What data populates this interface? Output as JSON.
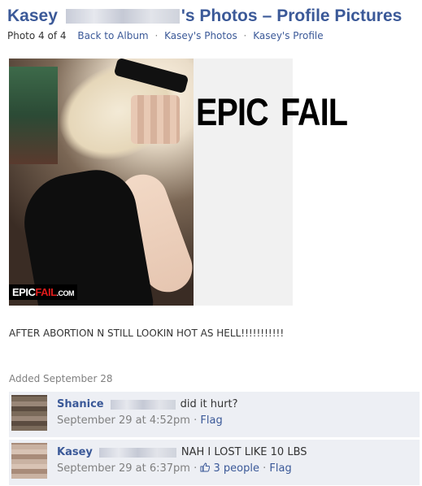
{
  "header": {
    "owner_name": "Kasey",
    "title_suffix": "'s Photos",
    "separator": "–",
    "album_title": "Profile Pictures"
  },
  "subnav": {
    "photo_position": "Photo 4 of 4",
    "links": [
      "Back to Album",
      "Kasey's Photos",
      "Kasey's Profile"
    ],
    "dot": "·"
  },
  "photo": {
    "overlay_text": "EPIC  FAIL",
    "badge": {
      "part1": "EPIC",
      "part2": "FAIL",
      "suffix": ".COM"
    }
  },
  "caption": "AFTER ABORTION N STILL LOOKIN HOT AS HELL!!!!!!!!!!!",
  "added": "Added September 28",
  "comments": [
    {
      "author": "Shanice",
      "text": "did it hurt?",
      "timestamp": "September 29 at 4:52pm",
      "flag": "Flag"
    },
    {
      "author": "Kasey",
      "text": "NAH I LOST LIKE 10 LBS",
      "timestamp": "September 29 at 6:37pm",
      "likes": "3 people",
      "flag": "Flag"
    }
  ],
  "colors": {
    "link": "#3b5998",
    "comment_bg": "#edeff4",
    "muted": "#808080"
  }
}
